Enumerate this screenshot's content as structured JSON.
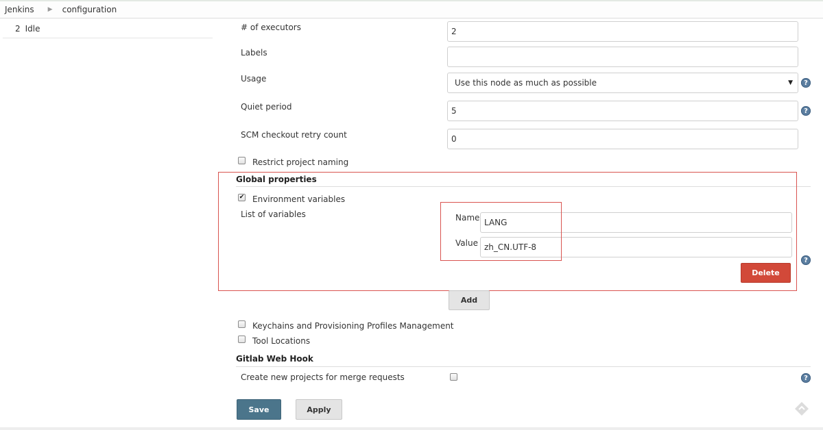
{
  "breadcrumb": {
    "root": "Jenkins",
    "current": "configuration"
  },
  "executor": {
    "number": "2",
    "status": "Idle"
  },
  "fields": {
    "executors_label": "# of executors",
    "executors_value": "2",
    "labels_label": "Labels",
    "labels_value": "",
    "usage_label": "Usage",
    "usage_value": "Use this node as much as possible",
    "quiet_label": "Quiet period",
    "quiet_value": "5",
    "scm_label": "SCM checkout retry count",
    "scm_value": "0",
    "restrict_label": "Restrict project naming"
  },
  "global": {
    "title": "Global properties",
    "env_label": "Environment variables",
    "list_label": "List of variables",
    "name_label": "Name",
    "name_value": "LANG",
    "value_label": "Value",
    "value_value": "zh_CN.UTF-8",
    "delete_label": "Delete",
    "add_label": "Add"
  },
  "options": {
    "keychains_label": "Keychains and Provisioning Profiles Management",
    "tool_label": "Tool Locations"
  },
  "gitlab": {
    "title": "Gitlab Web Hook",
    "merge_label": "Create new projects for merge requests"
  },
  "actions": {
    "save_label": "Save",
    "apply_label": "Apply"
  },
  "help_glyph": "?",
  "colors": {
    "save": "#4b758b",
    "delete": "#d24939",
    "highlight": "#d9534f",
    "help": "#5b7ea0"
  }
}
